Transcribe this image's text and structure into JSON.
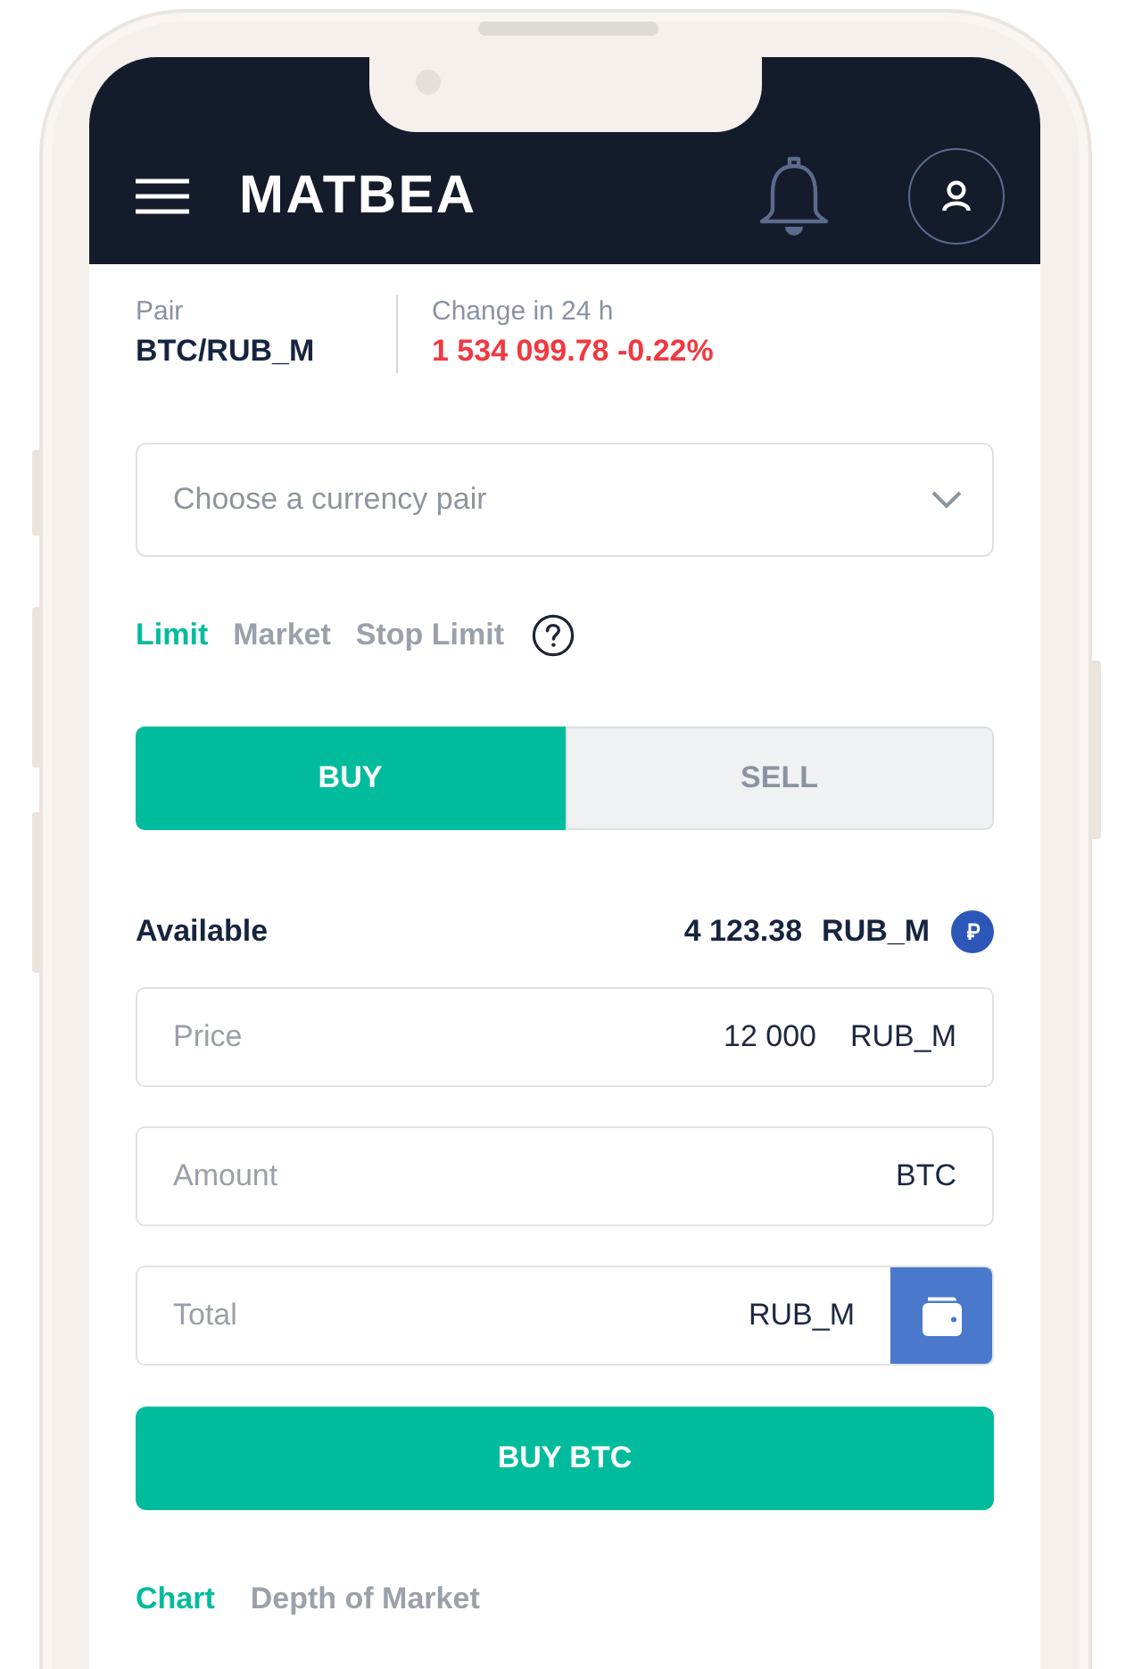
{
  "header": {
    "title": "MATBEA"
  },
  "pair_info": {
    "pair_label": "Pair",
    "pair": "BTC/RUB_M",
    "change_label": "Change in 24 h",
    "change": "1 534 099.78 -0.22%"
  },
  "pair_select": {
    "placeholder": "Choose a currency pair"
  },
  "order_types": [
    {
      "label": "Limit",
      "selected": true
    },
    {
      "label": "Market",
      "selected": false
    },
    {
      "label": "Stop Limit",
      "selected": false
    }
  ],
  "sides": [
    {
      "label": "BUY",
      "selected": true
    },
    {
      "label": "SELL",
      "selected": false
    }
  ],
  "available": {
    "label": "Available",
    "amount": "4 123.38",
    "currency": "RUB_M"
  },
  "fields": [
    {
      "label": "Price",
      "value": "12 000",
      "unit": "RUB_M",
      "wallet_button": false
    },
    {
      "label": "Amount",
      "unit": "BTC",
      "wallet_button": false
    },
    {
      "label": "Total",
      "unit": "RUB_M",
      "wallet_button": true
    }
  ],
  "submit": {
    "label": "BUY BTC"
  },
  "chart_tabs": [
    {
      "label": "Chart",
      "selected": true
    },
    {
      "label": "Depth of Market",
      "selected": false
    }
  ]
}
